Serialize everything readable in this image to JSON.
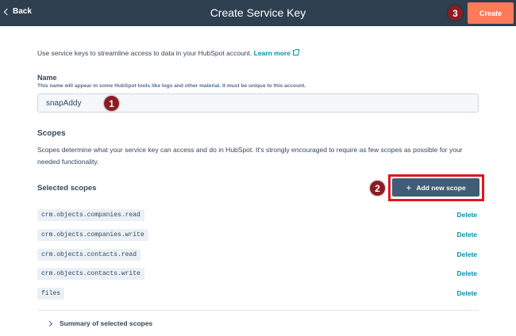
{
  "header": {
    "back_label": "Back",
    "title": "Create Service Key",
    "create_label": "Create"
  },
  "markers": {
    "m1": "1",
    "m2": "2",
    "m3": "3"
  },
  "intro": {
    "text": "Use service keys to streamline access to data in your HubSpot account.",
    "link": "Learn more"
  },
  "name_section": {
    "label": "Name",
    "help": "This name will appear in some HubSpot tools like logs and other material. It must be unique to this account.",
    "value": "snapAddy"
  },
  "scopes": {
    "heading": "Scopes",
    "description": "Scopes determine what your service key can access and do in HubSpot. It's strongly encouraged to require as few scopes as possible for your needed functionality.",
    "selected_heading": "Selected scopes",
    "add_button": "Add new scope",
    "items": [
      {
        "name": "crm.objects.companies.read",
        "action": "Delete"
      },
      {
        "name": "crm.objects.companies.write",
        "action": "Delete"
      },
      {
        "name": "crm.objects.contacts.read",
        "action": "Delete"
      },
      {
        "name": "crm.objects.contacts.write",
        "action": "Delete"
      },
      {
        "name": "files",
        "action": "Delete"
      }
    ],
    "summary_label": "Summary of selected scopes"
  },
  "colors": {
    "header_bg": "#2e3f50",
    "create_button": "#ff7a59",
    "add_button": "#425b76",
    "link": "#0091ae",
    "highlight": "#e0161c",
    "marker": "#8b1d22"
  }
}
